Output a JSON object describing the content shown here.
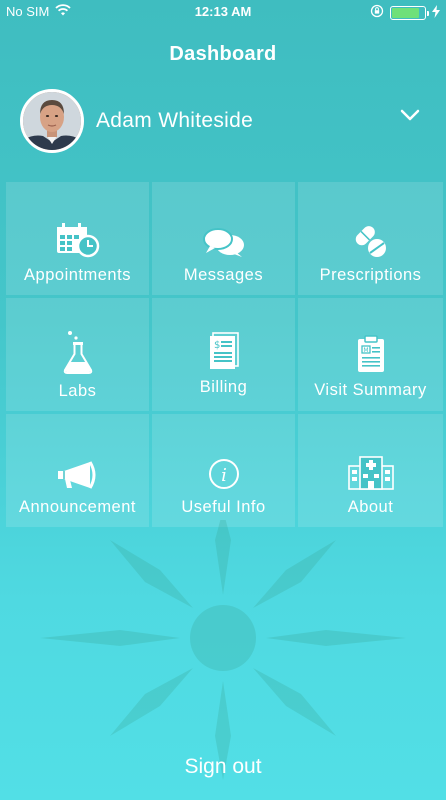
{
  "status_bar": {
    "carrier": "No SIM",
    "time": "12:13 AM",
    "battery_percent": 85
  },
  "header": {
    "title": "Dashboard"
  },
  "profile": {
    "name": "Adam Whiteside"
  },
  "tiles": [
    {
      "label": "Appointments",
      "icon": "calendar-clock-icon"
    },
    {
      "label": "Messages",
      "icon": "chat-bubbles-icon"
    },
    {
      "label": "Prescriptions",
      "icon": "pills-icon"
    },
    {
      "label": "Labs",
      "icon": "flask-icon"
    },
    {
      "label": "Billing",
      "icon": "bill-icon"
    },
    {
      "label": "Visit Summary",
      "icon": "clipboard-icon"
    },
    {
      "label": "Announcement",
      "icon": "megaphone-icon"
    },
    {
      "label": "Useful Info",
      "icon": "info-icon"
    },
    {
      "label": "About",
      "icon": "hospital-icon"
    }
  ],
  "footer": {
    "signout_label": "Sign out"
  }
}
